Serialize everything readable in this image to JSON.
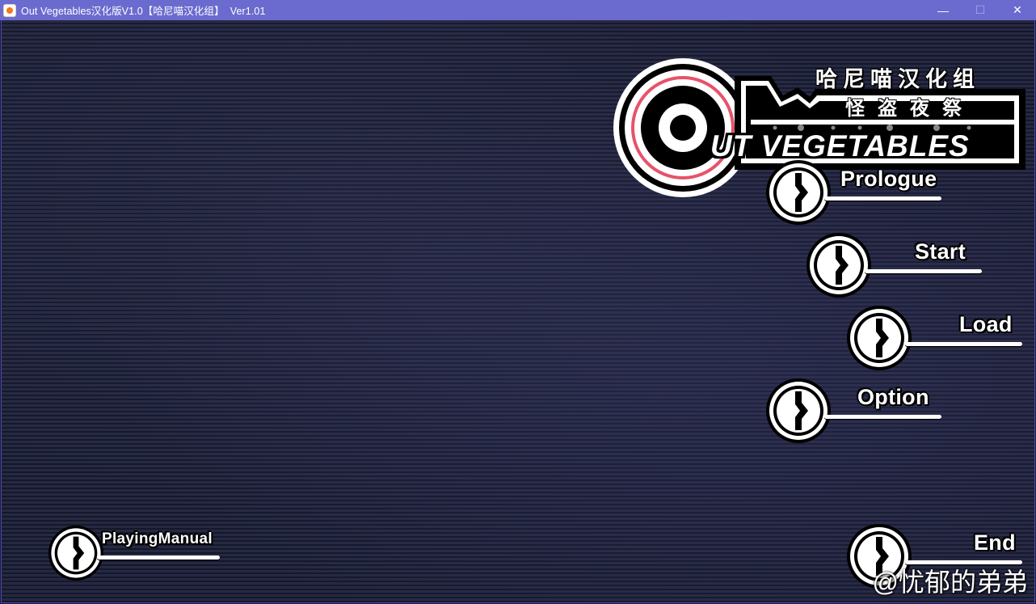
{
  "window": {
    "title": "Out Vegetables汉化版V1.0【哈尼喵汉化组】  Ver1.01",
    "minimize": "—",
    "maximize": "☐",
    "close": "✕"
  },
  "logo": {
    "group": "哈尼喵汉化组",
    "subtitle": "怪盗夜祭",
    "title": "UT VEGETABLES"
  },
  "menu": {
    "prologue": "Prologue",
    "start": "Start",
    "load": "Load",
    "option": "Option",
    "manual": "PlayingManual",
    "end": "End"
  },
  "watermark": "@忧郁的弟弟",
  "colors": {
    "titlebar": "#6b6bcf",
    "logo_ring": "#e8526a",
    "background": "#1a1c33"
  }
}
